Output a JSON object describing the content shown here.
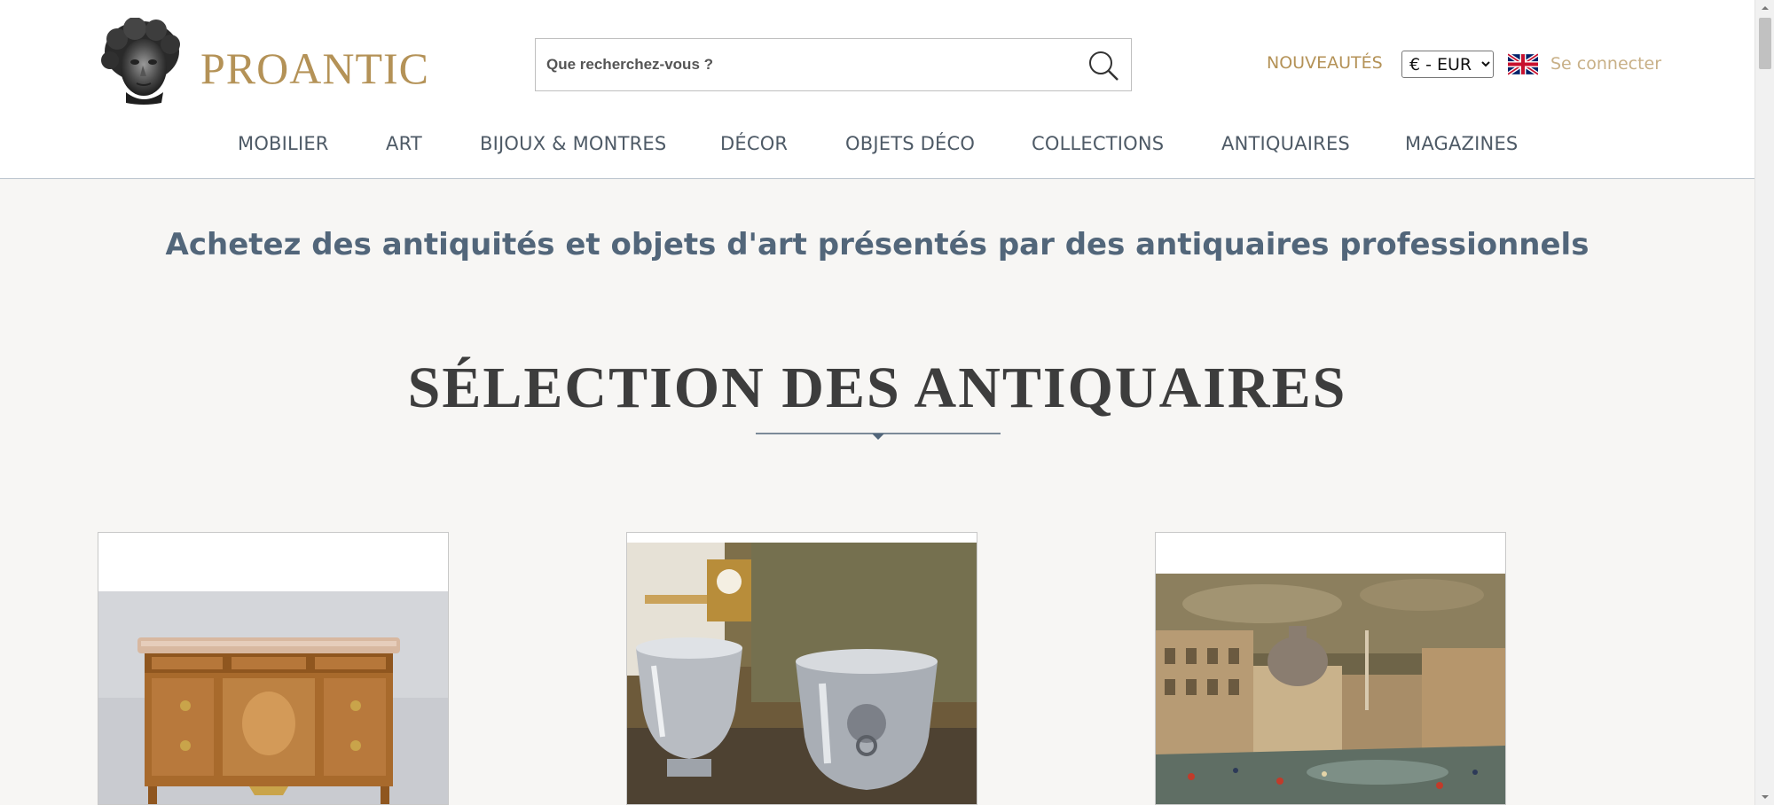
{
  "brand": {
    "name": "PROANTIC",
    "color": "#b49257"
  },
  "search": {
    "placeholder": "Que recherchez-vous ?",
    "icon": "search-icon"
  },
  "header_links": {
    "nouveautes": "NOUVEAUTÉS",
    "currency_selected": "€ - EUR",
    "language_flag": "uk-flag-icon",
    "login": "Se connecter"
  },
  "nav": {
    "items": [
      {
        "label": "MOBILIER"
      },
      {
        "label": "ART"
      },
      {
        "label": "BIJOUX & MONTRES"
      },
      {
        "label": "DÉCOR"
      },
      {
        "label": "OBJETS DÉCO"
      },
      {
        "label": "COLLECTIONS"
      },
      {
        "label": "ANTIQUAIRES"
      },
      {
        "label": "MAGAZINES"
      }
    ]
  },
  "main": {
    "tagline": "Achetez des antiquités et objets d'art présentés par des antiquaires professionnels",
    "section_title": "SÉLECTION DES ANTIQUAIRES"
  },
  "cards": [
    {
      "image": "marquetry-commode-photo"
    },
    {
      "image": "silver-wine-coolers-photo"
    },
    {
      "image": "piazza-navona-painting-photo"
    }
  ],
  "colors": {
    "accent_gold": "#b49257",
    "nav_text": "#4e5a66",
    "tagline_blue": "#52667a",
    "background": "#f7f6f4"
  }
}
